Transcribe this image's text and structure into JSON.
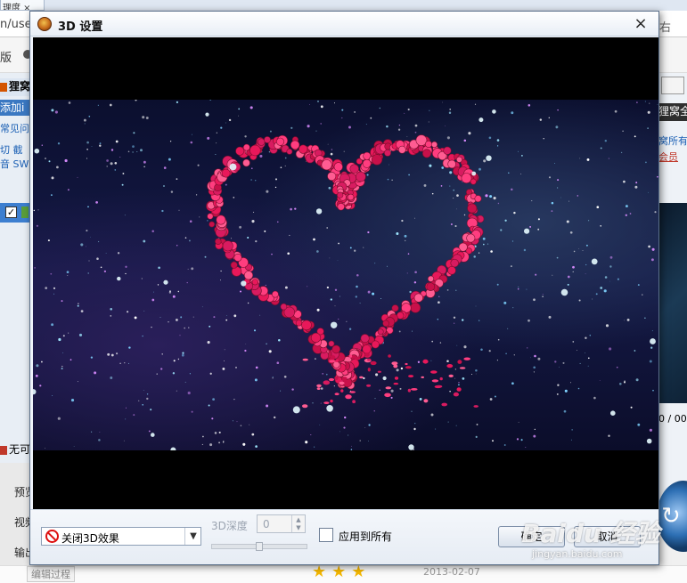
{
  "background": {
    "tab_label": "理度",
    "address_fragment": "n/use",
    "address_right": "右",
    "menu_fragment": "版",
    "app_title": "狸窝",
    "add_button": "添加i",
    "faq_link": "常见问",
    "cut_text": "切 截",
    "audio_text": "音 SWF",
    "none_label": "无可",
    "preview_label": "预览",
    "video_label": "视频",
    "output_label": "输出",
    "right_title": "狸窝全",
    "right_owned": "窝所有",
    "right_member": "会员",
    "right_time": "0 / 00",
    "right_replay_glyph": "↻",
    "edit_record": "编辑过程",
    "stars": "★★★",
    "date": "2013-02-07"
  },
  "dialog": {
    "title": "3D 设置",
    "close_glyph": "×",
    "effect_select": {
      "value": "关闭3D效果",
      "arrow_glyph": "▼"
    },
    "depth": {
      "label": "3D深度",
      "value": "0",
      "slider_value": 0.5
    },
    "apply_all": {
      "label": "应用到所有",
      "checked": false
    },
    "ok_label": "确定",
    "cancel_label": "取消"
  },
  "icons": {
    "app": "swirl-logo-icon",
    "close": "close-icon",
    "ban": "ban-icon",
    "chevron": "chevron-down-icon",
    "spin_up": "triangle-up-icon",
    "spin_down": "triangle-down-icon"
  },
  "colors": {
    "ban_red": "#dd1111",
    "rose_pink": "#e8185a",
    "frame_blue": "#151a47"
  },
  "watermark": {
    "logo": "Baidu 经验",
    "url": "jingyan.baidu.com"
  }
}
